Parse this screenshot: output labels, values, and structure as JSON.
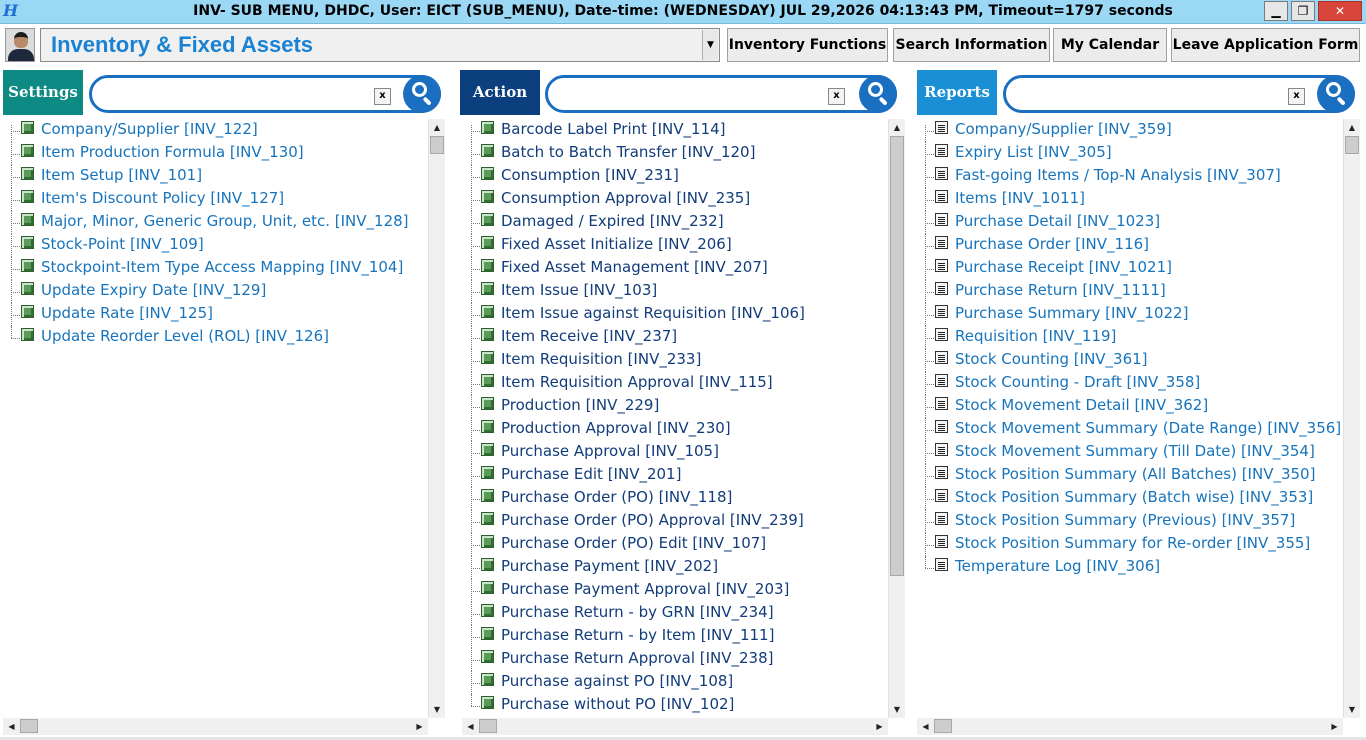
{
  "window": {
    "title": "INV- SUB MENU, DHDC, User: EICT (SUB_MENU), Date-time: (WEDNESDAY) JUL 29,2026 04:13:43 PM, Timeout=1797 seconds",
    "app_icon": "H",
    "minimize_label": "▁",
    "maximize_label": "❐",
    "close_label": "✕"
  },
  "header": {
    "module": "Inventory & Fixed Assets",
    "buttons": [
      "Inventory Functions",
      "Search Information",
      "My Calendar",
      "Leave Application Form"
    ]
  },
  "settings": {
    "label": "Settings",
    "color": "#0d8a84",
    "clear_label": "x",
    "items": [
      "Company/Supplier [INV_122]",
      "Item Production Formula [INV_130]",
      "Item Setup [INV_101]",
      "Item's Discount Policy [INV_127]",
      "Major, Minor, Generic Group, Unit, etc. [INV_128]",
      "Stock-Point [INV_109]",
      "Stockpoint-Item Type Access Mapping [INV_104]",
      "Update Expiry Date [INV_129]",
      "Update Rate [INV_125]",
      "Update Reorder Level (ROL) [INV_126]"
    ]
  },
  "action": {
    "label": "Action",
    "color": "#0b3f7e",
    "clear_label": "x",
    "items": [
      "Barcode Label Print [INV_114]",
      "Batch to Batch Transfer [INV_120]",
      "Consumption [INV_231]",
      "Consumption Approval [INV_235]",
      "Damaged / Expired [INV_232]",
      "Fixed Asset Initialize [INV_206]",
      "Fixed Asset Management [INV_207]",
      "Item Issue [INV_103]",
      "Item Issue against Requisition [INV_106]",
      "Item Receive [INV_237]",
      "Item Requisition [INV_233]",
      "Item Requisition Approval [INV_115]",
      "Production [INV_229]",
      "Production Approval [INV_230]",
      "Purchase Approval [INV_105]",
      "Purchase Edit [INV_201]",
      "Purchase Order (PO) [INV_118]",
      "Purchase Order (PO) Approval [INV_239]",
      "Purchase Order (PO) Edit [INV_107]",
      "Purchase Payment [INV_202]",
      "Purchase Payment Approval [INV_203]",
      "Purchase Return - by GRN [INV_234]",
      "Purchase Return - by Item [INV_111]",
      "Purchase Return Approval [INV_238]",
      "Purchase against PO [INV_108]",
      "Purchase without PO [INV_102]"
    ]
  },
  "reports": {
    "label": "Reports",
    "color": "#1a8fd6",
    "clear_label": "x",
    "items": [
      "Company/Supplier [INV_359]",
      "Expiry List [INV_305]",
      "Fast-going Items / Top-N Analysis [INV_307]",
      "Items [INV_1011]",
      "Purchase Detail [INV_1023]",
      "Purchase Order [INV_116]",
      "Purchase Receipt [INV_1021]",
      "Purchase Return [INV_1111]",
      "Purchase Summary [INV_1022]",
      "Requisition [INV_119]",
      "Stock Counting [INV_361]",
      "Stock Counting - Draft [INV_358]",
      "Stock Movement Detail [INV_362]",
      "Stock Movement Summary (Date Range) [INV_356]",
      "Stock Movement Summary (Till Date) [INV_354]",
      "Stock Position Summary (All Batches) [INV_350]",
      "Stock Position Summary (Batch wise) [INV_353]",
      "Stock Position Summary (Previous) [INV_357]",
      "Stock Position Summary for Re-order [INV_355]",
      "Temperature Log [INV_306]"
    ]
  },
  "icons": {
    "settings_item": "form-icon",
    "action_item": "form-icon",
    "report_item": "report-icon",
    "search": "search-icon"
  }
}
